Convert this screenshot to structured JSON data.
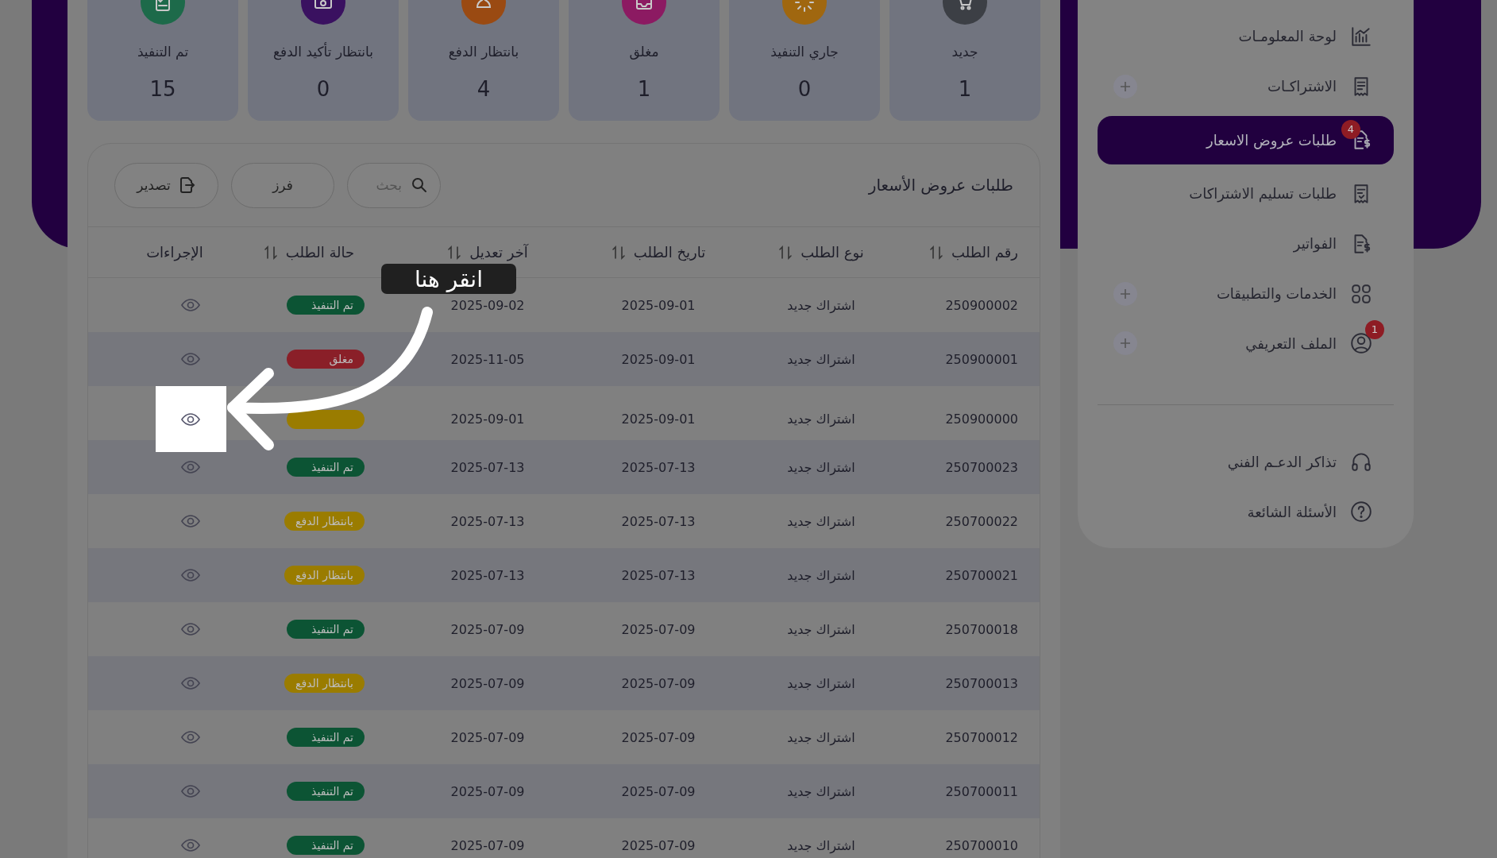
{
  "stats": [
    {
      "kind": "new",
      "label": "جديد",
      "count": "1"
    },
    {
      "kind": "in_progress",
      "label": "جاري التنفيذ",
      "count": "0"
    },
    {
      "kind": "closed",
      "label": "مغلق",
      "count": "1"
    },
    {
      "kind": "awaiting_payment",
      "label": "بانتظار الدفع",
      "count": "4"
    },
    {
      "kind": "awaiting_confirmation",
      "label": "بانتظار تأكيد الدفع",
      "count": "0"
    },
    {
      "kind": "done",
      "label": "تم التنفيذ",
      "count": "15"
    }
  ],
  "table": {
    "title": "طلبات عروض الأسعار",
    "search": {
      "placeholder": "بحث"
    },
    "sort_button": "فرز",
    "export_button": "تصدير",
    "columns": [
      {
        "label": "رقم الطلب",
        "sortable": true
      },
      {
        "label": "نوع الطلب",
        "sortable": true
      },
      {
        "label": "تاريخ الطلب",
        "sortable": true
      },
      {
        "label": "آخر تعديل",
        "sortable": true
      },
      {
        "label": "حالة الطلب",
        "sortable": true
      },
      {
        "label": "الإجراءات",
        "sortable": false
      }
    ],
    "rows": [
      {
        "number": "250900002",
        "type": "اشتراك جديد",
        "date": "2025-09-01",
        "modified": "2025-09-02",
        "status": {
          "kind": "done",
          "label": "تم التنفيذ"
        },
        "highlighted": false
      },
      {
        "number": "250900001",
        "type": "اشتراك جديد",
        "date": "2025-09-01",
        "modified": "2025-11-05",
        "status": {
          "kind": "closed",
          "label": "مغلق"
        },
        "highlighted": false
      },
      {
        "number": "250900000",
        "type": "اشتراك جديد",
        "date": "2025-09-01",
        "modified": "2025-09-01",
        "status": {
          "kind": "pending"
        },
        "highlighted": true
      },
      {
        "number": "250700023",
        "type": "اشتراك جديد",
        "date": "2025-07-13",
        "modified": "2025-07-13",
        "status": {
          "kind": "done",
          "label": "تم التنفيذ"
        },
        "highlighted": false
      },
      {
        "number": "250700022",
        "type": "اشتراك جديد",
        "date": "2025-07-13",
        "modified": "2025-07-13",
        "status": {
          "kind": "pending",
          "label": "بانتظار الدفع"
        },
        "highlighted": false
      },
      {
        "number": "250700021",
        "type": "اشتراك جديد",
        "date": "2025-07-13",
        "modified": "2025-07-13",
        "status": {
          "kind": "pending",
          "label": "بانتظار الدفع"
        },
        "highlighted": false
      },
      {
        "number": "250700018",
        "type": "اشتراك جديد",
        "date": "2025-07-09",
        "modified": "2025-07-09",
        "status": {
          "kind": "done",
          "label": "تم التنفيذ"
        },
        "highlighted": false
      },
      {
        "number": "250700013",
        "type": "اشتراك جديد",
        "date": "2025-07-09",
        "modified": "2025-07-09",
        "status": {
          "kind": "pending",
          "label": "بانتظار الدفع"
        },
        "highlighted": false
      },
      {
        "number": "250700012",
        "type": "اشتراك جديد",
        "date": "2025-07-09",
        "modified": "2025-07-09",
        "status": {
          "kind": "done",
          "label": "تم التنفيذ"
        },
        "highlighted": false
      },
      {
        "number": "250700011",
        "type": "اشتراك جديد",
        "date": "2025-07-09",
        "modified": "2025-07-09",
        "status": {
          "kind": "done",
          "label": "تم التنفيذ"
        },
        "highlighted": false
      },
      {
        "number": "250700010",
        "type": "اشتراك جديد",
        "date": "2025-07-09",
        "modified": "2025-07-09",
        "status": {
          "kind": "done",
          "label": "تم التنفيذ"
        },
        "highlighted": false
      }
    ]
  },
  "sidebar": {
    "items": [
      {
        "label": "لوحة المعلومـات",
        "selected": false,
        "expandable": false
      },
      {
        "label": "الاشتراكـات",
        "selected": false,
        "expandable": true
      },
      {
        "label": "طلبات عروض الاسعار",
        "selected": true,
        "expandable": false,
        "badge": "4"
      },
      {
        "label": "طلبات تسليم الاشتراكات",
        "selected": false,
        "expandable": false
      },
      {
        "label": "الفواتير",
        "selected": false,
        "expandable": false
      },
      {
        "label": "الخدمات والتطبيقات",
        "selected": false,
        "expandable": true
      },
      {
        "label": "الملف التعريفي",
        "selected": false,
        "expandable": true,
        "badge": "1"
      }
    ],
    "footer_items": [
      {
        "label": "تذاكر الدعـم الفني",
        "selected": false,
        "expandable": false
      },
      {
        "label": "الأسئلة الشائعة",
        "selected": false,
        "expandable": false
      }
    ]
  },
  "tutorial": {
    "tooltip": "انقر هنا"
  }
}
